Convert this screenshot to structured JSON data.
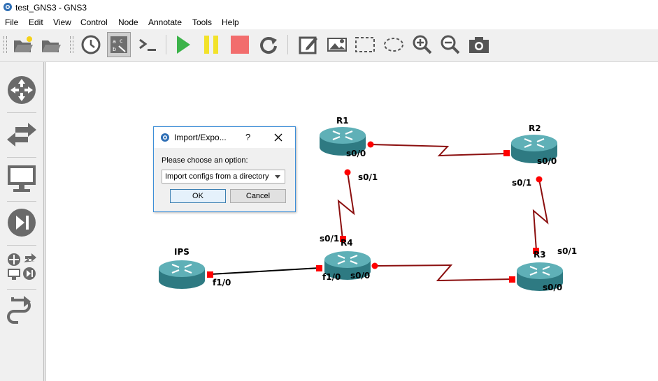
{
  "window": {
    "title": "test_GNS3 - GNS3"
  },
  "menu": [
    "File",
    "Edit",
    "View",
    "Control",
    "Node",
    "Annotate",
    "Tools",
    "Help"
  ],
  "toolbar": {
    "icons": [
      "open-project-icon",
      "open-folder-icon",
      "snapshot-clock-icon",
      "show-interface-labels-icon",
      "console-all-icon",
      "start-all-icon",
      "suspend-all-icon",
      "stop-all-icon",
      "reload-all-icon",
      "add-note-icon",
      "insert-image-icon",
      "draw-rectangle-icon",
      "draw-ellipse-icon",
      "zoom-in-icon",
      "zoom-out-icon",
      "screenshot-icon"
    ],
    "colors": {
      "start": "#3cb34a",
      "suspend": "#f2e22a",
      "stop": "#f26d6d"
    }
  },
  "dock": {
    "icons": [
      "routers-icon",
      "switches-icon",
      "end-devices-icon",
      "security-devices-icon",
      "all-devices-icon",
      "add-link-icon"
    ]
  },
  "topology": {
    "nodes": [
      "R1",
      "R2",
      "R3",
      "R4",
      "IPS"
    ],
    "interface_labels": {
      "r1_s00": "s0/0",
      "r1_s01": "s0/1",
      "r2_s00": "s0/0",
      "r2_s01": "s0/1",
      "r3_s01": "s0/1",
      "r3_s00": "s0/0",
      "r4_s01": "s0/1",
      "r4_f10": "f1/0",
      "r4_s00": "s0/0",
      "ips_f10": "f1/0"
    },
    "colors": {
      "serial_link": "#8b0f0f",
      "ethernet_link": "#000000",
      "router_body": "#3d8f96",
      "status": "#ff0000"
    }
  },
  "dialog": {
    "title": "Import/Expo...",
    "help": "?",
    "prompt": "Please choose an option:",
    "selected_option": "Import configs from a directory",
    "ok_label": "OK",
    "cancel_label": "Cancel"
  }
}
